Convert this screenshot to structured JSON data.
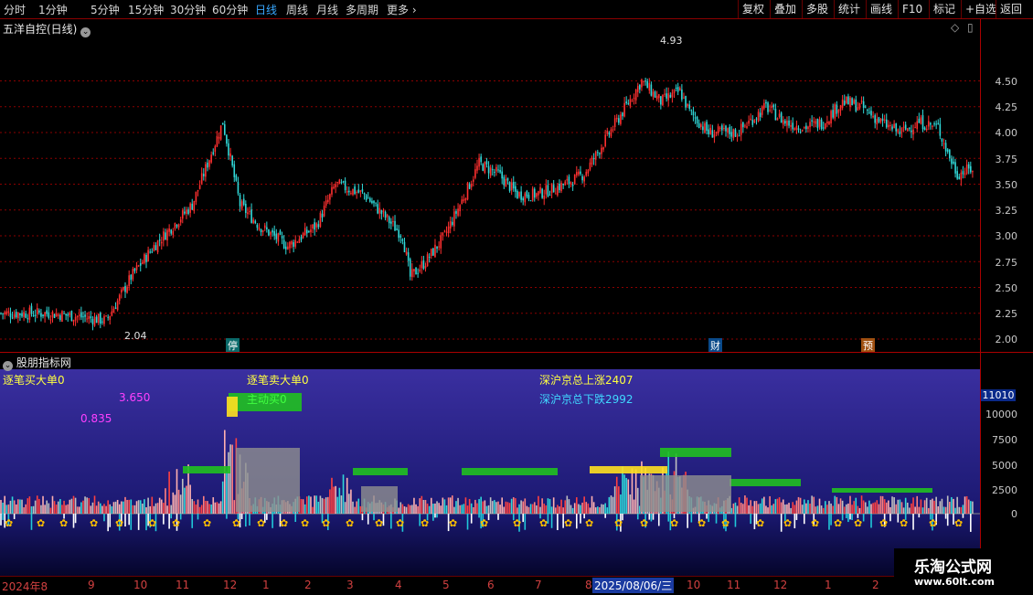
{
  "toolbar": {
    "periods": [
      "分时",
      "1分钟",
      "5分钟",
      "15分钟",
      "30分钟",
      "60分钟",
      "日线",
      "周线",
      "月线",
      "多周期",
      "更多"
    ],
    "active_period": "日线",
    "buttons": [
      "复权",
      "叠加",
      "多股",
      "统计",
      "画线",
      "F10",
      "标记",
      "+自选",
      "返回"
    ]
  },
  "main": {
    "title": "五洋自控(日线)",
    "price_high_label": "4.93",
    "price_low_label": "2.04",
    "axis_ticks": [
      "4.50",
      "4.25",
      "4.00",
      "3.75",
      "3.50",
      "3.25",
      "3.00",
      "2.75",
      "2.50",
      "2.25",
      "2.00"
    ],
    "markers": [
      "停",
      "财",
      "预"
    ],
    "colors": {
      "up": "#ff3030",
      "down": "#30d8d8",
      "grid": "#8b0000"
    }
  },
  "sub": {
    "title": "股朋指标网",
    "labels": {
      "big_buy": "逐笔买大单0",
      "big_sell": "逐笔卖大单0",
      "active_buy": "主动买0",
      "up_count": "深沪京总上涨2407",
      "down_count": "深沪京总下跌2992",
      "v1": "3.650",
      "v2": "0.835"
    },
    "axis_current": "11010",
    "axis_ticks": [
      "10000",
      "7500",
      "5000",
      "2500",
      "0"
    ]
  },
  "dates": {
    "labels": [
      "2024年8",
      "9",
      "10",
      "11",
      "12",
      "1",
      "2",
      "3",
      "4",
      "5",
      "6",
      "7",
      "8",
      "10",
      "11",
      "12",
      "1",
      "2"
    ],
    "highlight": "2025/08/06/三"
  },
  "watermark": {
    "title": "乐淘公式网",
    "url": "www.60lt.com"
  }
}
